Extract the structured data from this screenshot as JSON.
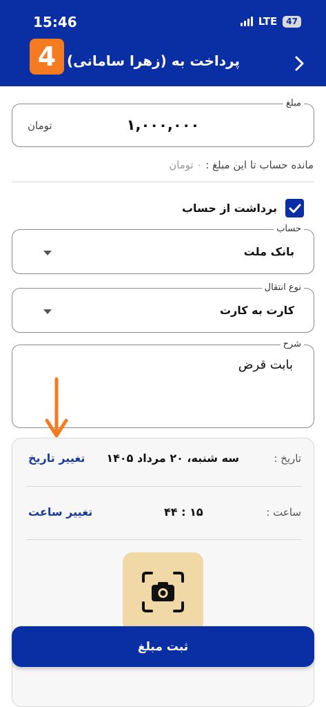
{
  "status_bar": {
    "time": "15:46",
    "network": "LTE",
    "battery": "47"
  },
  "header": {
    "badge": "4",
    "title": "پرداخت به (زهرا سامانی)"
  },
  "amount": {
    "legend": "مبلغ",
    "value": "۱,۰۰۰,۰۰۰",
    "currency": "تومان"
  },
  "balance": {
    "label": "مانده حساب تا این مبلغ :",
    "value": "۰ تومان"
  },
  "withdraw": {
    "label": "برداشت از حساب",
    "checked": true
  },
  "account": {
    "legend": "حساب",
    "value": "بانک ملت"
  },
  "transfer": {
    "legend": "نوع انتقال",
    "value": "کارت به کارت"
  },
  "description": {
    "legend": "شرح",
    "value": "بابت قرض"
  },
  "date_row": {
    "label": "تاریخ :",
    "value": "سه شنبه، ۲۰ مرداد ۱۴۰۵",
    "action": "تغییر تاریخ"
  },
  "time_row": {
    "label": "ساعت :",
    "value": "۱۵ : ۴۴",
    "action": "تغییر ساعت"
  },
  "submit_label": "ثبت مبلغ",
  "colors": {
    "primary": "#0a2fa4",
    "badge": "#f47b20",
    "camera_bg": "#f0d9a6",
    "arrow": "#f47b20"
  },
  "icons": {
    "back": "chevron-right-icon",
    "camera": "camera-scan-icon",
    "check": "checkmark-icon",
    "caret": "caret-down-icon"
  }
}
